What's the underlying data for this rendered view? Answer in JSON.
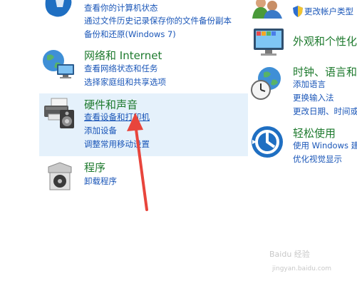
{
  "left": {
    "system": {
      "links": [
        "查看你的计算机状态",
        "通过文件历史记录保存你的文件备份副本",
        "备份和还原(Windows 7)"
      ]
    },
    "network": {
      "title": "网络和 Internet",
      "links": [
        "查看网络状态和任务",
        "选择家庭组和共享选项"
      ]
    },
    "hardware": {
      "title": "硬件和声音",
      "links": [
        "查看设备和打印机",
        "添加设备",
        "调整常用移动设置"
      ]
    },
    "programs": {
      "title": "程序",
      "links": [
        "卸载程序"
      ]
    }
  },
  "right": {
    "accounts": {
      "links": [
        "更改帐户类型"
      ]
    },
    "appearance": {
      "title": "外观和个性化"
    },
    "clock": {
      "title": "时钟、语言和",
      "links": [
        "添加语言",
        "更换输入法",
        "更改日期、时间或"
      ]
    },
    "ease": {
      "title": "轻松使用",
      "links": [
        "使用 Windows 建",
        "优化视觉显示"
      ]
    }
  },
  "watermark": {
    "line1": "Baidu 经验",
    "line2": "jingyan.baidu.com"
  },
  "colors": {
    "title": "#1e7a2e",
    "link": "#1a56b8",
    "highlight": "#e5f1fb",
    "arrow": "#e8453c"
  }
}
